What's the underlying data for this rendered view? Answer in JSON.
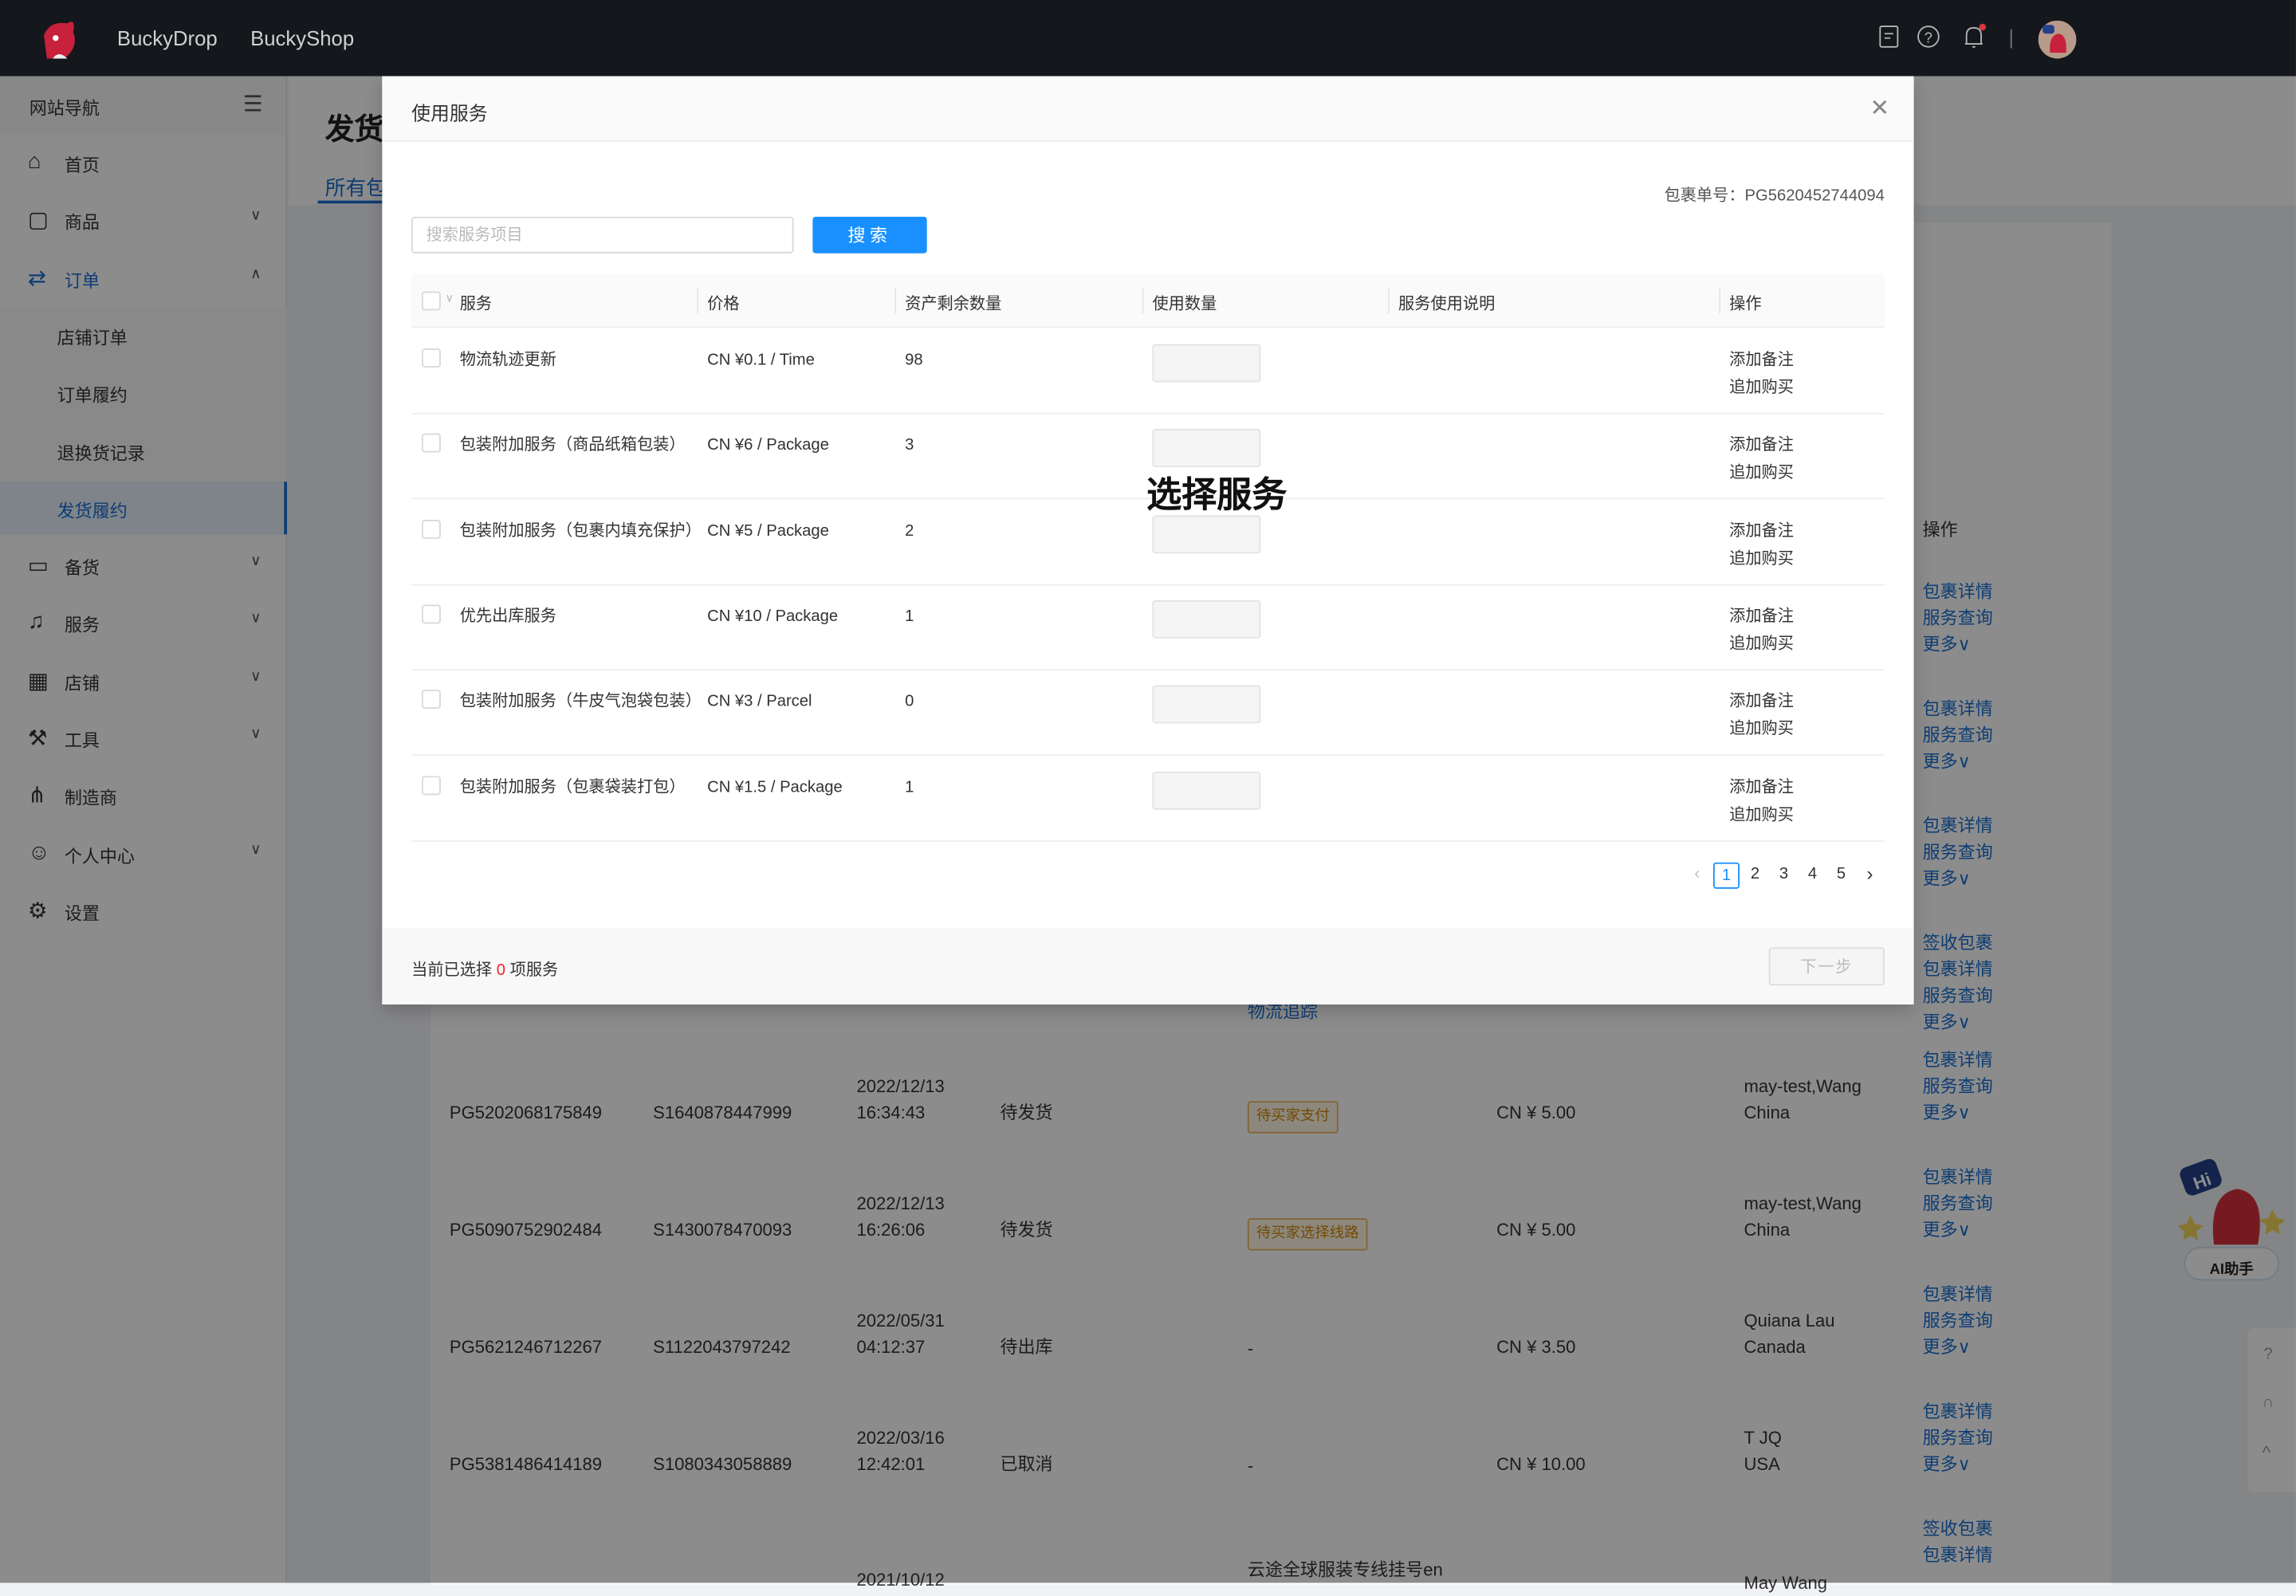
{
  "topbar": {
    "brands": [
      "BuckyDrop",
      "BuckyShop"
    ],
    "icons": [
      "document-icon",
      "help-icon",
      "bell-icon"
    ],
    "notification_dot": true
  },
  "sidebar": {
    "title": "网站导航",
    "items": [
      {
        "label": "首页",
        "icon": "home-icon",
        "expand": ""
      },
      {
        "label": "商品",
        "icon": "bag-icon",
        "expand": "down"
      },
      {
        "label": "订单",
        "icon": "order-icon",
        "expand": "up",
        "active": true,
        "children": [
          "店铺订单",
          "订单履约",
          "退换货记录",
          "发货履约"
        ],
        "active_child": "发货履约"
      },
      {
        "label": "备货",
        "icon": "box-icon",
        "expand": "down"
      },
      {
        "label": "服务",
        "icon": "bell-service-icon",
        "expand": "down"
      },
      {
        "label": "店铺",
        "icon": "store-icon",
        "expand": "down"
      },
      {
        "label": "工具",
        "icon": "wrench-icon",
        "expand": "down"
      },
      {
        "label": "制造商",
        "icon": "network-icon",
        "expand": ""
      },
      {
        "label": "个人中心",
        "icon": "user-icon",
        "expand": "down"
      },
      {
        "label": "设置",
        "icon": "gear-icon",
        "expand": ""
      }
    ]
  },
  "page": {
    "title": "发货",
    "tab": "所有包",
    "ops_header": "操作",
    "logistics_link": "物流追踪",
    "ops_column": [
      [
        "包裹详情",
        "服务查询",
        "更多∨"
      ],
      [
        "包裹详情",
        "服务查询",
        "更多∨"
      ],
      [
        "包裹详情",
        "服务查询",
        "更多∨"
      ],
      [
        "签收包裹",
        "包裹详情",
        "服务查询",
        "更多∨"
      ],
      [
        "包裹详情",
        "服务查询",
        "更多∨"
      ],
      [
        "包裹详情",
        "服务查询",
        "更多∨"
      ],
      [
        "包裹详情",
        "服务查询",
        "更多∨"
      ],
      [
        "包裹详情",
        "服务查询",
        "更多∨"
      ],
      [
        "签收包裹",
        "包裹详情"
      ]
    ],
    "rows": [
      {
        "pkg": "PG5202068175849",
        "order": "S1640878447999",
        "date": "2022/12/13",
        "time": "16:34:43",
        "status": "待发货",
        "tag": "待买家支付",
        "price": "CN ¥ 5.00",
        "name": "may-test,Wang",
        "country": "China"
      },
      {
        "pkg": "PG5090752902484",
        "order": "S1430078470093",
        "date": "2022/12/13",
        "time": "16:26:06",
        "status": "待发货",
        "tag": "待买家选择线路",
        "price": "CN ¥ 5.00",
        "name": "may-test,Wang",
        "country": "China"
      },
      {
        "pkg": "PG5621246712267",
        "order": "S1122043797242",
        "date": "2022/05/31",
        "time": "04:12:37",
        "status": "待出库",
        "tag": "-",
        "price": "CN ¥ 3.50",
        "name": "Quiana Lau",
        "country": "Canada"
      },
      {
        "pkg": "PG5381486414189",
        "order": "S1080343058889",
        "date": "2022/03/16",
        "time": "12:42:01",
        "status": "已取消",
        "tag": "-",
        "price": "CN ¥ 10.00",
        "name": "T JQ",
        "country": "USA"
      }
    ],
    "partial_row": {
      "date": "2021/10/12",
      "route": "云途全球服装专线挂号en",
      "name": "May Wang"
    }
  },
  "modal": {
    "title": "使用服务",
    "package_no": "包裹单号：PG5620452744094",
    "search_placeholder": "搜索服务项目",
    "search_button": "搜索",
    "columns": [
      "服务",
      "价格",
      "资产剩余数量",
      "使用数量",
      "服务使用说明",
      "操作"
    ],
    "rows": [
      {
        "service": "物流轨迹更新",
        "price": "CN ¥0.1 / Time",
        "remaining": "98",
        "qty": "",
        "desc": ""
      },
      {
        "service": "包装附加服务（商品纸箱包装）",
        "price": "CN ¥6 / Package",
        "remaining": "3",
        "qty": "",
        "desc": ""
      },
      {
        "service": "包装附加服务（包裹内填充保护）",
        "price": "CN ¥5 / Package",
        "remaining": "2",
        "qty": "",
        "desc": ""
      },
      {
        "service": "优先出库服务",
        "price": "CN ¥10 / Package",
        "remaining": "1",
        "qty": "",
        "desc": ""
      },
      {
        "service": "包装附加服务（牛皮气泡袋包装）",
        "price": "CN ¥3 / Parcel",
        "remaining": "0",
        "qty": "",
        "desc": ""
      },
      {
        "service": "包装附加服务（包裹袋装打包）",
        "price": "CN ¥1.5 / Package",
        "remaining": "1",
        "qty": "",
        "desc": ""
      }
    ],
    "row_actions": [
      "添加备注",
      "追加购买"
    ],
    "pages": [
      "1",
      "2",
      "3",
      "4",
      "5"
    ],
    "current_page": "1",
    "footer_prefix": "当前已选择 ",
    "selected_count": "0",
    "footer_suffix": " 项服务",
    "next_button": "下一步",
    "annotation": "选择服务"
  },
  "assistant": {
    "label": "AI助手",
    "bubble": "Hi"
  },
  "colors": {
    "primary": "#1890ff",
    "link": "#1a6fd1",
    "topbar": "#14171b",
    "danger": "#f5222d",
    "tag": "#d48806"
  }
}
